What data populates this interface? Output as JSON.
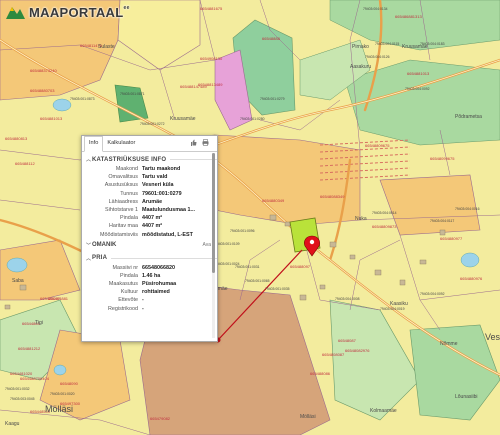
{
  "brand": {
    "logo_text": "MAAPORTAAL",
    "logo_sup": "ee"
  },
  "colors": {
    "yellow_parcel": "#f7ee9c",
    "orange_parcel": "#f4c878",
    "brown_parcel": "#d6a47a",
    "green_parcel": "#8fcf9d",
    "pink_parcel": "#e7a2d8",
    "road": "#f0b060",
    "selected": "#b9e23a",
    "marker": "#e0101b"
  },
  "map_labels": [
    "6654811476",
    "665488373240",
    "66548880703",
    "66548813489",
    "665488147489",
    "6654908130",
    "665486881313",
    "6654881013",
    "66548888",
    "6654881675",
    "79403:001:0873",
    "79403:001:0871",
    "79403:001:0272",
    "79403:001:0280",
    "79403:001:0279",
    "79403:004:0134",
    "79403:004:0115",
    "79403:004:0126",
    "79403:004:0092",
    "79403:004:0183",
    "6654880813",
    "66548809675",
    "66548099675",
    "6654880349",
    "66548088349",
    "79403:004:0014",
    "79403:004:0117",
    "79403:004:0016",
    "6654881013",
    "665488112",
    "66548809873",
    "665488087",
    "6654880977",
    "665488097",
    "79403:001:0031",
    "79403:001:0109",
    "79403:001:0096",
    "665494881",
    "66544860",
    "6654881212",
    "6654880976",
    "665448509",
    "665497300",
    "6654481020",
    "79403:004:0008",
    "79403:004:0019",
    "79403:004:0092",
    "66548087",
    "6654808087",
    "665488086",
    "66548082976",
    "79403:001:0024",
    "79403:001:0035",
    "79403:001:0065",
    "6654488709404",
    "66548090",
    "665479082",
    "79403:001:0032",
    "79403:001:0020",
    "79403:003:0045"
  ],
  "place_names": [
    "Pirnako",
    "Kruusamäe",
    "Aasakuru",
    "Kruusamäe",
    "Põdrametsa",
    "Sulaste",
    "Mölläsi",
    "Mölläsi",
    "Saba",
    "Tigi",
    "Kaasiku",
    "Arumäe",
    "Vesi",
    "Kolmaamäe",
    "Nõmme",
    "Lõunasiibi",
    "Kaagu",
    "Nuka"
  ],
  "panel": {
    "tabs": [
      "Info",
      "Kalkulaator"
    ],
    "cadastral_section": "KATASTRIÜKSUSE INFO",
    "cadastral": [
      {
        "k": "Maakond",
        "v": "Tartu maakond"
      },
      {
        "k": "Omavalitsus",
        "v": "Tartu vald"
      },
      {
        "k": "Asustusüksus",
        "v": "Vesneri küla"
      },
      {
        "k": "Tunnus",
        "v": "79601:001:0279"
      },
      {
        "k": "Lähiaadress",
        "v": "Arumäe"
      },
      {
        "k": "Sihtotstarve 1",
        "v": "Maatulundusmaa 1..."
      },
      {
        "k": "Pindala",
        "v": "4407 m²"
      },
      {
        "k": "Haritav maa",
        "v": "4407 m²"
      },
      {
        "k": "Mõõdistamisviis",
        "v": "mõõdistatud, L-EST"
      }
    ],
    "owner_section": "OMANIK",
    "owner_more": "Ava",
    "pria_section": "PRIA",
    "pria": [
      {
        "k": "Massiivi nr",
        "v": "66548066820"
      },
      {
        "k": "Pindala",
        "v": "1.46 ha"
      },
      {
        "k": "Maakasutus",
        "v": "Püsirohumaa"
      },
      {
        "k": "Kultuur",
        "v": "rohttaimed"
      },
      {
        "k": "Ettevõte",
        "v": "-"
      },
      {
        "k": "Registrikood",
        "v": "-"
      }
    ]
  }
}
